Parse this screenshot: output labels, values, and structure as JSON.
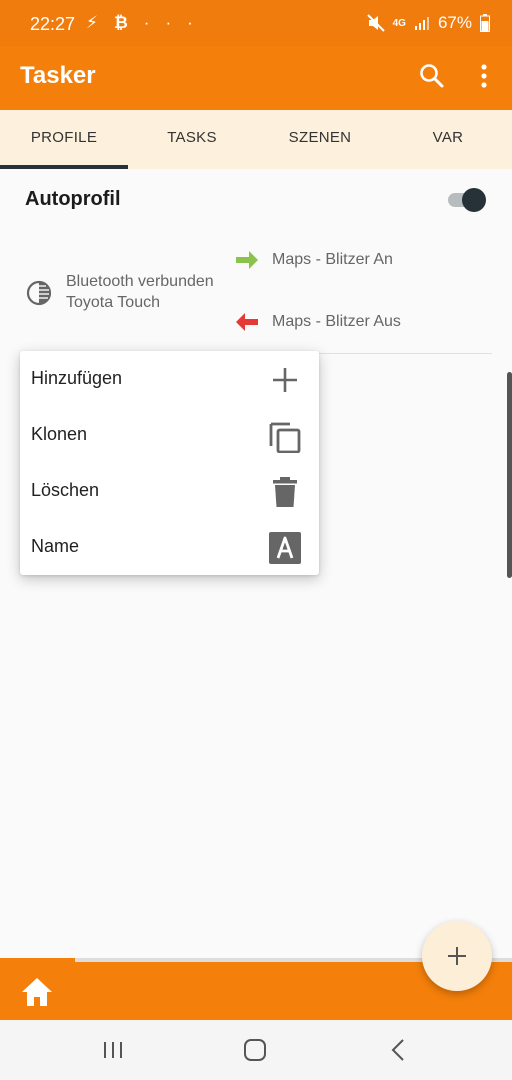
{
  "status_bar": {
    "time": "22:27",
    "left_icons": [
      "flash-icon",
      "bitcoin-icon",
      "more-notifications-icon"
    ],
    "network": "4G",
    "battery": "67%"
  },
  "app_bar": {
    "title": "Tasker",
    "icons": [
      "search-icon",
      "more-vert-icon"
    ]
  },
  "tabs": [
    {
      "label": "PROFILE",
      "active": true
    },
    {
      "label": "TASKS",
      "active": false
    },
    {
      "label": "SZENEN",
      "active": false
    },
    {
      "label": "VAR",
      "active": false
    }
  ],
  "profile": {
    "name": "Autoprofil",
    "enabled": true,
    "context": {
      "icon": "contrast-icon",
      "line1": "Bluetooth verbunden",
      "line2": "Toyota Touch"
    },
    "enter_task": {
      "icon": "arrow-right-icon",
      "label": "Maps - Blitzer An",
      "color": "#8bc34a"
    },
    "exit_task": {
      "icon": "arrow-left-icon",
      "label": "Maps - Blitzer Aus",
      "color": "#e53935"
    }
  },
  "context_menu": {
    "items": [
      {
        "label": "Hinzufügen",
        "icon": "plus-icon"
      },
      {
        "label": "Klonen",
        "icon": "copy-icon"
      },
      {
        "label": "Löschen",
        "icon": "trash-icon"
      },
      {
        "label": "Name",
        "icon": "text-a-icon"
      }
    ]
  },
  "colors": {
    "accent": "#f47f0a",
    "tab_background": "#fdf0dc",
    "toggle_thumb": "#263238",
    "fab_background": "#fdeed8"
  },
  "bottom_bar": {
    "icon": "home-icon"
  },
  "nav_bar": {
    "icons": [
      "recents-icon",
      "home-nav-icon",
      "back-icon"
    ]
  }
}
